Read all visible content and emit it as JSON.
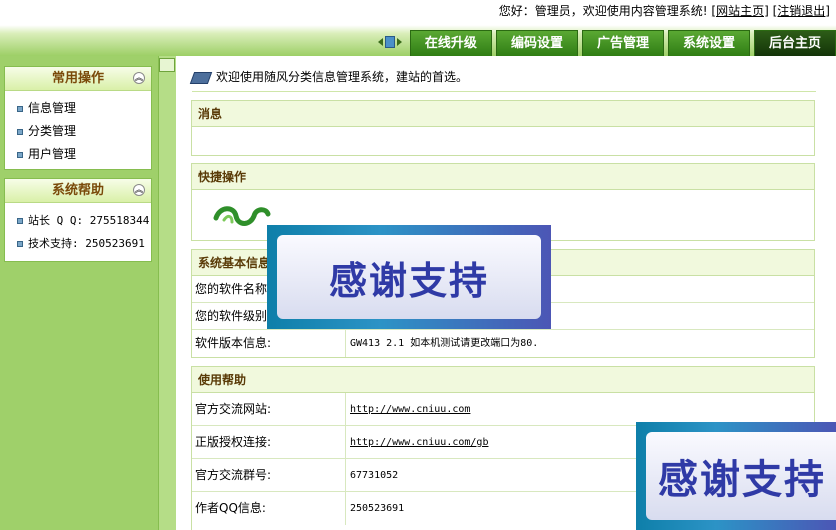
{
  "header": {
    "greeting": "您好：管理员，欢迎使用内容管理系统!",
    "site_home_link": "[网站主页]",
    "logout_link": "[注销退出]",
    "tabs": [
      {
        "label": "在线升级"
      },
      {
        "label": "编码设置"
      },
      {
        "label": "广告管理"
      },
      {
        "label": "系统设置"
      },
      {
        "label": "后台主页"
      }
    ]
  },
  "sidebar": {
    "panels": [
      {
        "title": "常用操作",
        "items": [
          {
            "label": "信息管理"
          },
          {
            "label": "分类管理"
          },
          {
            "label": "用户管理"
          }
        ]
      },
      {
        "title": "系统帮助",
        "items": [
          {
            "label": "站长 Q Q: 275518344"
          },
          {
            "label": "技术支持: 250523691"
          }
        ]
      }
    ]
  },
  "main": {
    "welcome": "欢迎使用随风分类信息管理系统，建站的首选。",
    "sections": {
      "messages": {
        "title": "消息"
      },
      "quick_ops": {
        "title": "快捷操作"
      },
      "sysinfo": {
        "title": "系统基本信息",
        "rows": [
          {
            "key": "您的软件名称",
            "value": ""
          },
          {
            "key": "您的软件级别",
            "value": ""
          },
          {
            "key": "软件版本信息:",
            "value": "GW413 2.1 如本机测试请更改端口为80."
          }
        ]
      },
      "help": {
        "title": "使用帮助",
        "rows": [
          {
            "key": "官方交流网站:",
            "value": "http://www.cniuu.com"
          },
          {
            "key": "正版授权连接:",
            "value": "http://www.cniuu.com/gb"
          },
          {
            "key": "官方交流群号:",
            "value": "67731052"
          },
          {
            "key": "作者QQ信息:",
            "value": "250523691"
          }
        ]
      }
    }
  },
  "overlays": {
    "banner_text": "感谢支持"
  },
  "colors": {
    "tab_green": "#2f7d14",
    "sidebar_green": "#9fd06a",
    "section_header": "#f1f9dd"
  }
}
